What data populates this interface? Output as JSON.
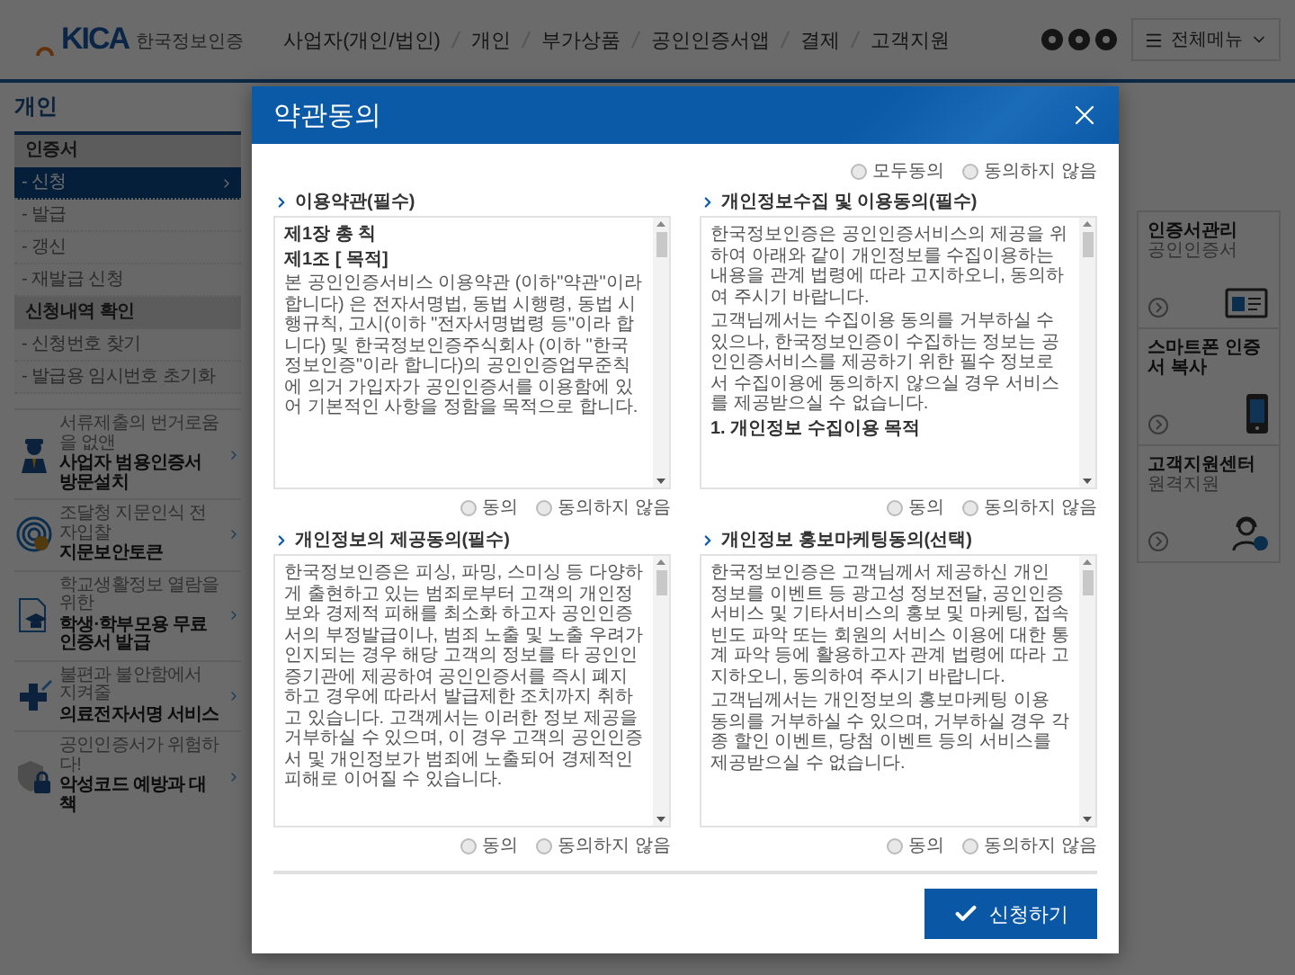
{
  "header": {
    "logo": {
      "mark": "KICA",
      "name": "한국정보인증"
    },
    "nav": [
      {
        "label": "사업자(개인/법인)"
      },
      {
        "label": "개인"
      },
      {
        "label": "부가상품"
      },
      {
        "label": "공인인증서앱"
      },
      {
        "label": "결제"
      },
      {
        "label": "고객지원"
      }
    ],
    "menu_button": {
      "label": "전체메뉴"
    }
  },
  "sidebar": {
    "title": "개인",
    "menu": [
      {
        "kind": "group",
        "label": "인증서",
        "selected": false
      },
      {
        "kind": "item",
        "label": "- 신청",
        "selected": true
      },
      {
        "kind": "item",
        "label": "- 발급",
        "selected": false
      },
      {
        "kind": "item",
        "label": "- 갱신",
        "selected": false
      },
      {
        "kind": "item",
        "label": "- 재발급 신청",
        "selected": false
      },
      {
        "kind": "group",
        "label": "신청내역 확인",
        "selected": false
      },
      {
        "kind": "item",
        "label": "- 신청번호 찾기",
        "selected": false
      },
      {
        "kind": "item",
        "label": "- 발급용 임시번호 초기화",
        "selected": false
      }
    ],
    "promos": [
      {
        "kind": "visit",
        "caption": "서류제출의 번거로움을 없앤",
        "title": "사업자 범용인증서 방문설치"
      },
      {
        "kind": "fingerprint",
        "caption": "조달청 지문인식 전자입찰",
        "title": "지문보안토큰"
      },
      {
        "kind": "student",
        "caption": "학교생활정보 열람을 위한",
        "title": "학생·학부모용 무료인증서 발급"
      },
      {
        "kind": "medical",
        "caption": "불편과 불안함에서 지켜줄",
        "title": "의료전자서명 서비스"
      },
      {
        "kind": "security",
        "caption": "공인인증서가 위험하다!",
        "title": "악성코드 예방과 대책"
      }
    ]
  },
  "quick_links": [
    {
      "kind": "card",
      "title": "인증서관리",
      "subtitle": "공인인증서"
    },
    {
      "kind": "phone",
      "title": "스마트폰 인증서 복사"
    },
    {
      "kind": "support",
      "title": "고객지원센터",
      "subtitle": "원격지원"
    }
  ],
  "modal": {
    "title": "약관동의",
    "all_options": [
      {
        "label": "모두동의",
        "selected": false
      },
      {
        "label": "동의하지 않음",
        "selected": false
      }
    ],
    "sections": [
      {
        "title": "이용약관(필수)",
        "paragraphs": [
          {
            "kind": "chapter",
            "text": "제1장 총 칙"
          },
          {
            "kind": "article",
            "text": "제1조 [ 목적]"
          },
          {
            "kind": "body",
            "text": "본 공인인증서비스 이용약관 (이하\"약관\"이라 합니다) 은 전자서명법, 동법 시행령, 동법 시행규칙, 고시(이하 \"전자서명법령 등\"이라 합니다) 및 한국정보인증주식회사 (이하 \"한국정보인증\"이라 합니다)의 공인인증업무준칙에 의거 가입자가 공인인증서를 이용함에 있어 기본적인 사항을 정함을 목적으로 합니다."
          }
        ],
        "options": [
          {
            "label": "동의",
            "selected": false
          },
          {
            "label": "동의하지 않음",
            "selected": false
          }
        ]
      },
      {
        "title": "개인정보수집 및 이용동의(필수)",
        "paragraphs": [
          {
            "kind": "body",
            "text": "한국정보인증은 공인인증서비스의 제공을 위하여 아래와 같이 개인정보를 수집이용하는 내용을 관계 법령에 따라 고지하오니, 동의하여 주시기 바랍니다."
          },
          {
            "kind": "body",
            "text": "고객님께서는 수집이용 동의를 거부하실 수 있으나, 한국정보인증이 수집하는 정보는 공인인증서비스를 제공하기 위한 필수 정보로서 수집이용에 동의하지 않으실 경우 서비스를 제공받으실 수 없습니다."
          },
          {
            "kind": "article",
            "text": "1. 개인정보 수집이용 목적"
          }
        ],
        "options": [
          {
            "label": "동의",
            "selected": false
          },
          {
            "label": "동의하지 않음",
            "selected": false
          }
        ]
      },
      {
        "title": "개인정보의 제공동의(필수)",
        "paragraphs": [
          {
            "kind": "body",
            "text": "한국정보인증은 피싱, 파밍, 스미싱 등 다양하게 출현하고 있는 범죄로부터 고객의 개인정보와 경제적 피해를 최소화 하고자 공인인증서의 부정발급이나, 범죄 노출 및 노출 우려가 인지되는 경우 해당 고객의 정보를 타 공인인증기관에 제공하여 공인인증서를 즉시 폐지하고 경우에 따라서 발급제한 조치까지 취하고 있습니다. 고객께서는 이러한 정보 제공을 거부하실 수 있으며, 이 경우 고객의 공인인증서 및 개인정보가 범죄에 노출되어 경제적인 피해로 이어질 수 있습니다."
          }
        ],
        "options": [
          {
            "label": "동의",
            "selected": false
          },
          {
            "label": "동의하지 않음",
            "selected": false
          }
        ]
      },
      {
        "title": "개인정보 홍보마케팅동의(선택)",
        "paragraphs": [
          {
            "kind": "body",
            "text": "한국정보인증은 고객님께서 제공하신 개인 정보를 이벤트 등 광고성 정보전달, 공인인증서비스 및 기타서비스의 홍보 및 마케팅, 접속빈도 파악 또는 회원의 서비스 이용에 대한 통계 파악 등에 활용하고자 관계 법령에 따라 고지하오니, 동의하여 주시기 바랍니다."
          },
          {
            "kind": "body",
            "text": "고객님께서는 개인정보의 홍보마케팅 이용 동의를 거부하실 수 있으며, 거부하실 경우 각종 할인 이벤트, 당첨 이벤트 등의 서비스를 제공받으실 수 없습니다."
          }
        ],
        "options": [
          {
            "label": "동의",
            "selected": false
          },
          {
            "label": "동의하지 않음",
            "selected": false
          }
        ]
      }
    ],
    "submit": {
      "label": "신청하기"
    }
  }
}
